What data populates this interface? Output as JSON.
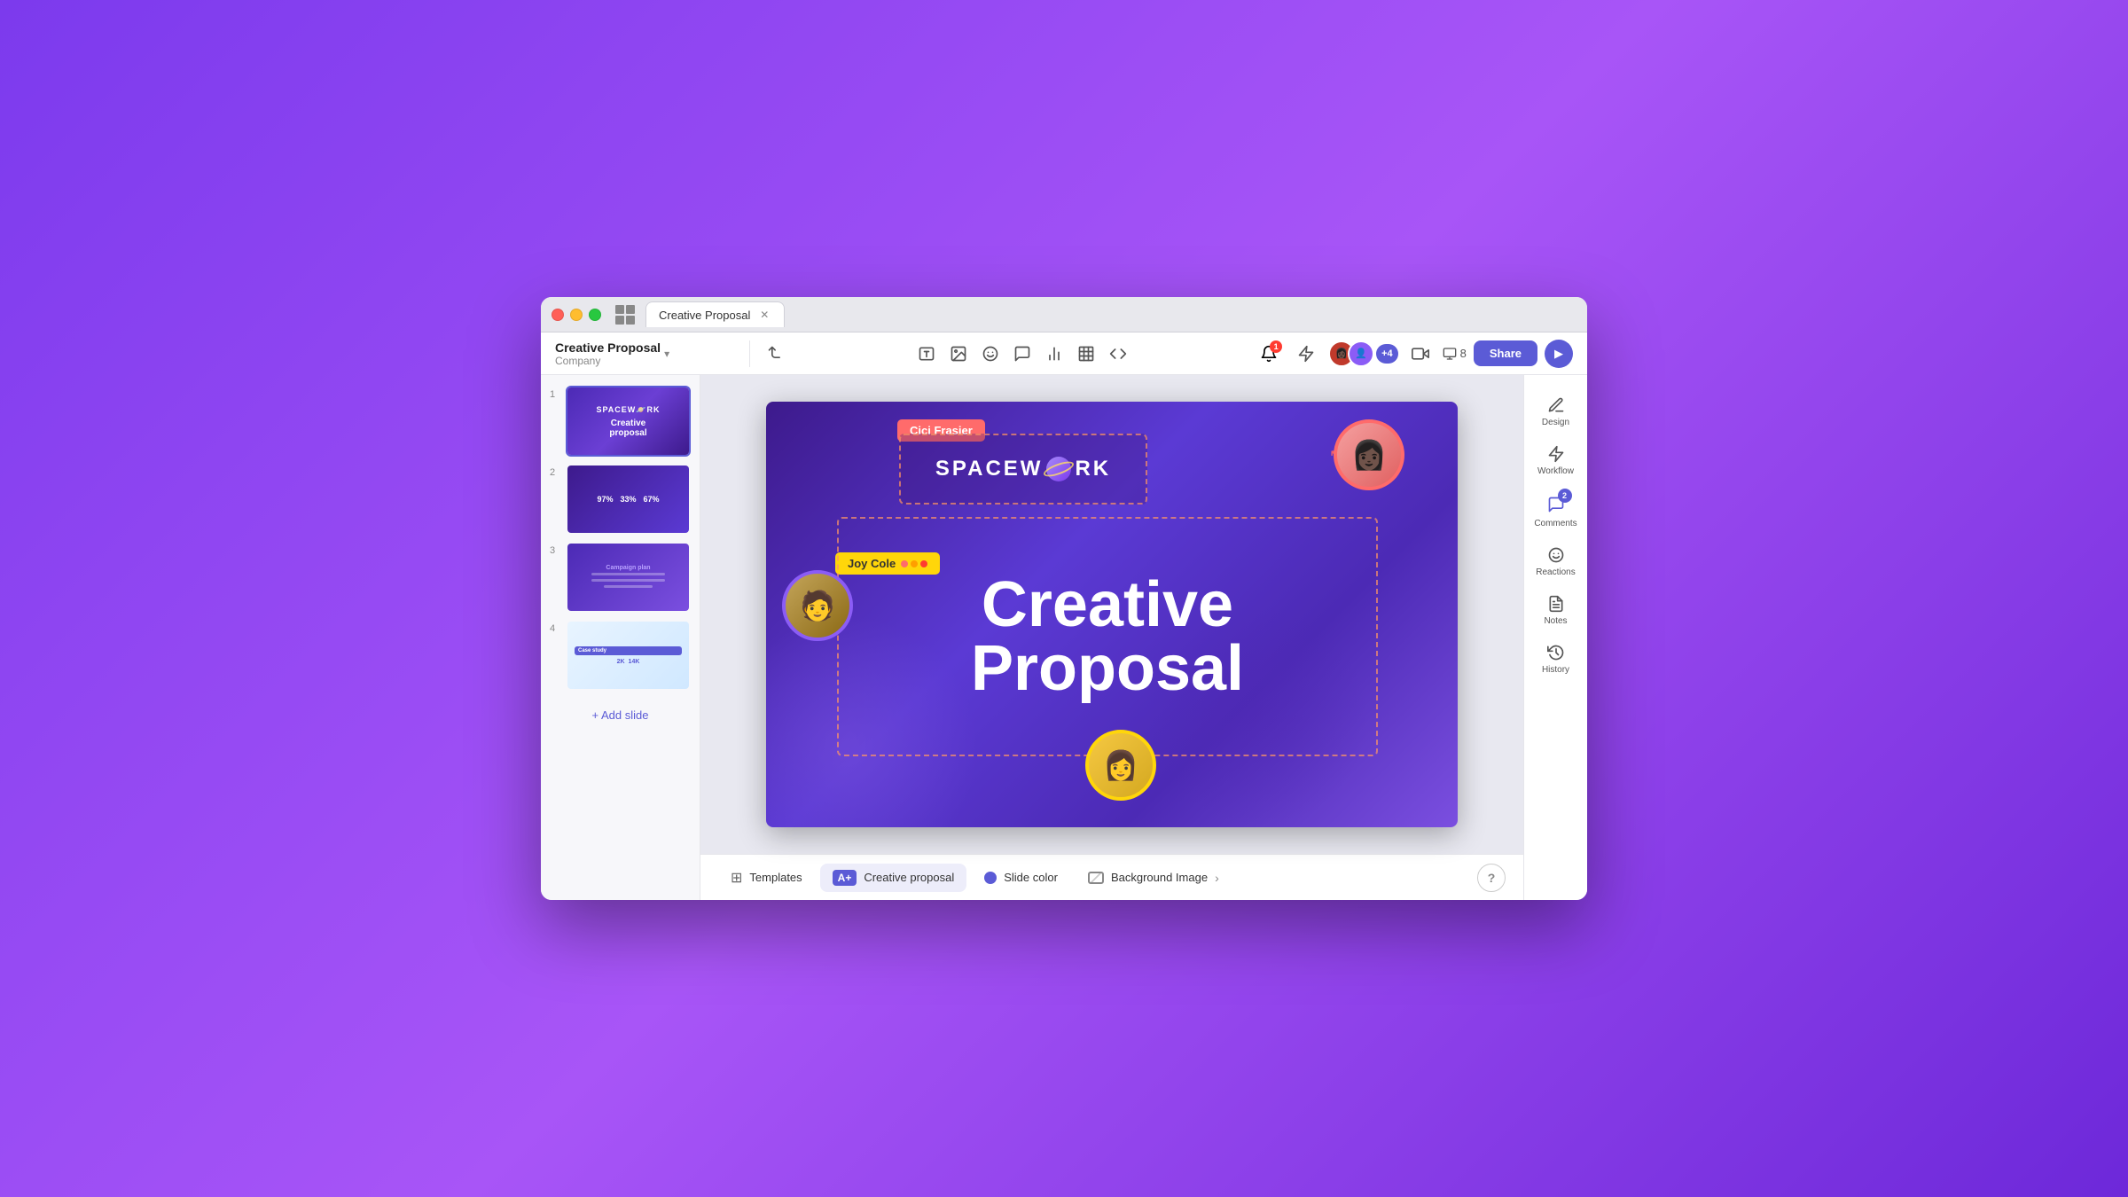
{
  "window": {
    "tab_title": "Creative Proposal",
    "traffic_lights": [
      "red",
      "yellow",
      "green"
    ]
  },
  "header": {
    "title": "Creative Proposal",
    "subtitle": "Company",
    "undo_label": "↩",
    "notification_count": "1",
    "avatars": [
      {
        "id": "a1",
        "emoji": "👩🏿",
        "color": "#c0392b"
      },
      {
        "id": "a2",
        "emoji": "👤",
        "color": "#8b5cf6"
      }
    ],
    "extra_count": "+4",
    "slides_count": "8",
    "share_label": "Share"
  },
  "slides": [
    {
      "num": "1",
      "active": true,
      "stats": []
    },
    {
      "num": "2",
      "active": false,
      "stats": [
        "97%",
        "33%",
        "67%"
      ]
    },
    {
      "num": "3",
      "active": false,
      "label": "Campaign plan"
    },
    {
      "num": "4",
      "active": false,
      "stats": [
        "2K",
        "14K"
      ]
    }
  ],
  "add_slide_label": "+ Add slide",
  "canvas": {
    "spacework_text": "SPACEW",
    "spacework_suffix": "RK",
    "creative_line1": "Creative",
    "creative_line2": "Proposal",
    "label_cici": "Cici Frasier",
    "label_joy": "Joy Cole"
  },
  "bottom_bar": {
    "templates_label": "Templates",
    "theme_label": "Creative proposal",
    "slide_color_label": "Slide color",
    "background_label": "Background Image",
    "help_label": "?"
  },
  "right_panel": {
    "items": [
      {
        "id": "design",
        "icon": "✏️",
        "label": "Design"
      },
      {
        "id": "workflow",
        "icon": "⚡",
        "label": "Workflow"
      },
      {
        "id": "comments",
        "icon": "💬",
        "label": "Comments",
        "badge": "2"
      },
      {
        "id": "reactions",
        "icon": "😊",
        "label": "Reactions"
      },
      {
        "id": "notes",
        "icon": "📝",
        "label": "Notes"
      },
      {
        "id": "history",
        "icon": "🕐",
        "label": "History"
      }
    ]
  }
}
